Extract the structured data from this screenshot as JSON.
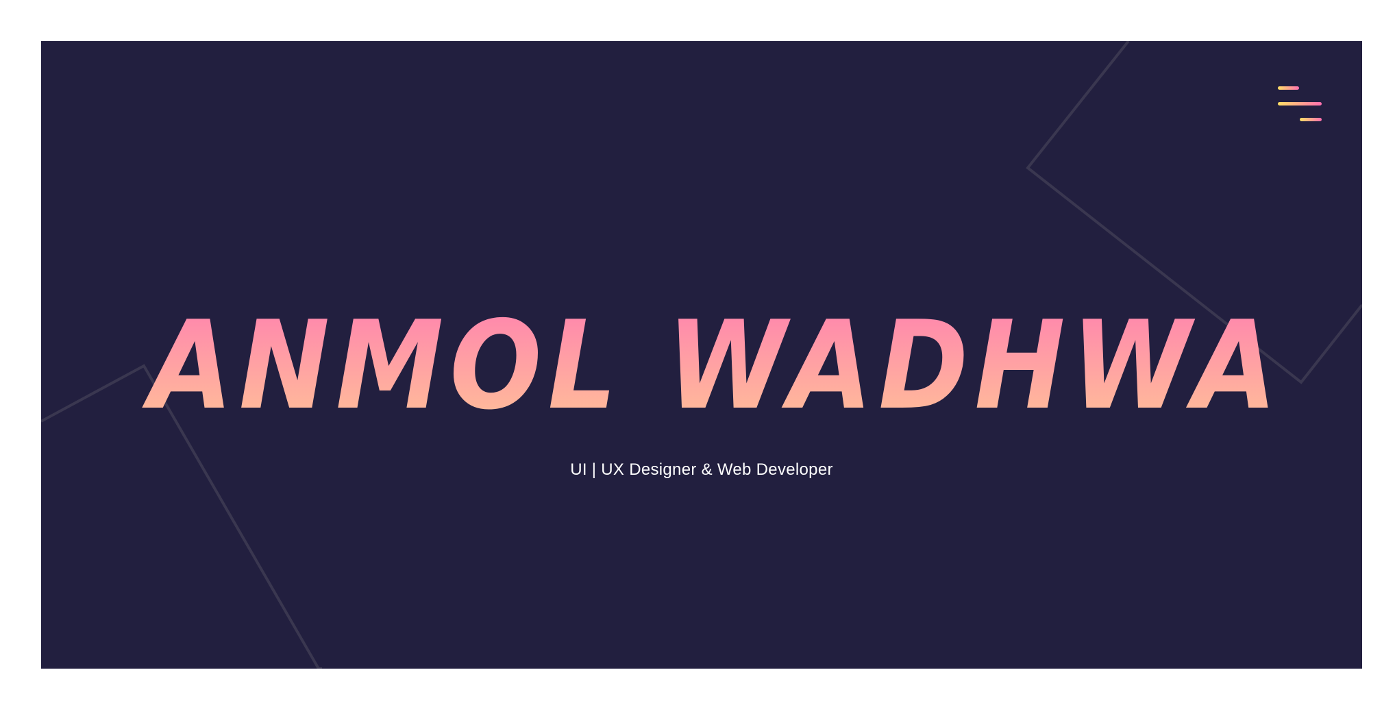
{
  "hero": {
    "name": "ANMOL WADHWA",
    "tagline": "UI | UX Designer & Web Developer"
  },
  "menu": {
    "icon": "hamburger-menu-icon"
  },
  "colors": {
    "background": "#221f3f",
    "page": "#ffffff",
    "name_gradient_top": "#ff7fb0",
    "name_gradient_bottom": "#ffc596",
    "menu_gradient_start": "#ffe066",
    "menu_gradient_end": "#ff6fb0",
    "decor_lines": "#3a3750"
  }
}
